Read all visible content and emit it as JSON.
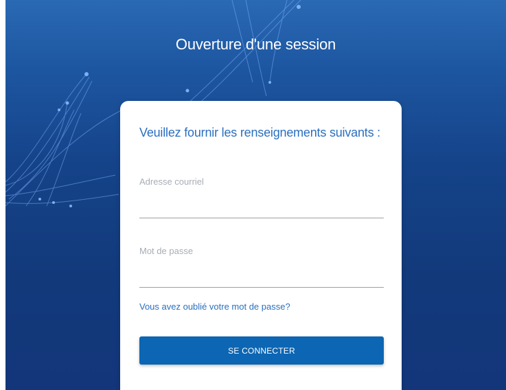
{
  "header": {
    "title": "Ouverture d'une session"
  },
  "form": {
    "subtitle": "Veuillez fournir les renseignements suivants :",
    "email": {
      "label": "Adresse courriel",
      "value": ""
    },
    "password": {
      "label": "Mot de passe",
      "value": ""
    },
    "forgot_password_link": "Vous avez oublié votre mot de passe?",
    "submit_button": "SE CONNECTER"
  },
  "colors": {
    "background_top": "#2a69b4",
    "background_bottom": "#13367a",
    "accent": "#2a6fbf",
    "button": "#0c66b3",
    "label": "#a7adb5"
  },
  "icons": {
    "background_art": "network-lines-art"
  }
}
